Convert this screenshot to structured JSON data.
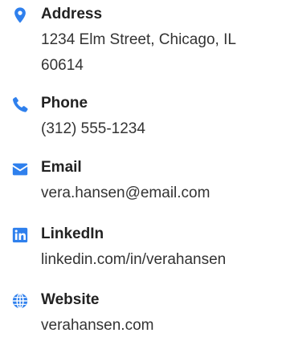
{
  "colors": {
    "icon": "#2f80ed",
    "label": "#222222",
    "value": "#333333"
  },
  "contacts": [
    {
      "icon": "map-marker-icon",
      "label": "Address",
      "value": "1234 Elm Street, Chicago, IL 60614"
    },
    {
      "icon": "phone-icon",
      "label": "Phone",
      "value": "(312) 555-1234"
    },
    {
      "icon": "envelope-icon",
      "label": "Email",
      "value": "vera.hansen@email.com"
    },
    {
      "icon": "linkedin-icon",
      "label": "LinkedIn",
      "value": "linkedin.com/in/verahansen"
    },
    {
      "icon": "globe-icon",
      "label": "Website",
      "value": "verahansen.com"
    }
  ]
}
